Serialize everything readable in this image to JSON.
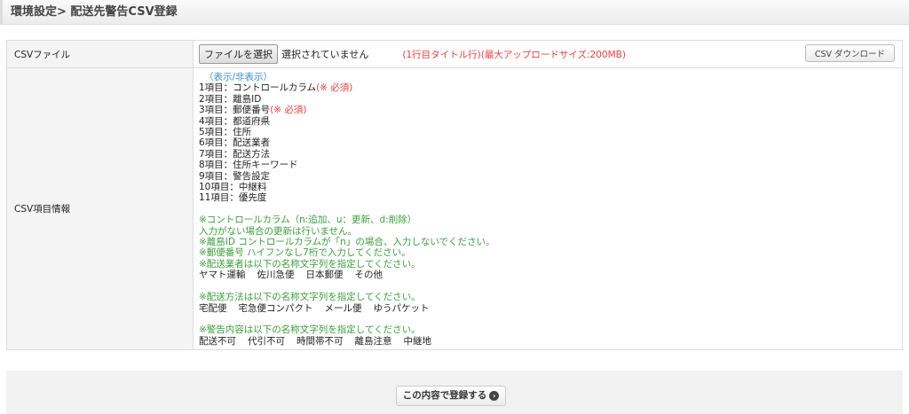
{
  "header": {
    "title": "環境設定> 配送先警告CSV登録"
  },
  "file_row": {
    "label": "CSVファイル",
    "choose_button": "ファイルを選択",
    "no_file": "選択されていません",
    "note": "(1行目タイトル行)(最大アップロードサイズ:200MB)",
    "download_button": "CSV ダウンロード"
  },
  "info_row": {
    "label": "CSV項目情報",
    "toggle": "（表示/非表示）",
    "items": [
      {
        "text": "1項目：コントロールカラム",
        "req": "(※ 必須)"
      },
      {
        "text": "2項目：離島ID",
        "req": ""
      },
      {
        "text": "3項目：郵便番号",
        "req": "(※ 必須)"
      },
      {
        "text": "4項目：都道府県",
        "req": ""
      },
      {
        "text": "5項目：住所",
        "req": ""
      },
      {
        "text": "6項目：配送業者",
        "req": ""
      },
      {
        "text": "7項目：配送方法",
        "req": ""
      },
      {
        "text": "8項目：住所キーワード",
        "req": ""
      },
      {
        "text": "9項目：警告設定",
        "req": ""
      },
      {
        "text": "10項目：中継料",
        "req": ""
      },
      {
        "text": "11項目：優先度",
        "req": ""
      }
    ],
    "notes": [
      "※コントロールカラム（n:追加、u：更新、d:削除）",
      "入力がない場合の更新は行いません。",
      "※離島ID コントロールカラムが「n」の場合、入力しないでください。",
      "※郵便番号 ハイフンなし7桁で入力してください。",
      "※配送業者は以下の名称文字列を指定してください。"
    ],
    "carriers": [
      "ヤマト運輸",
      "佐川急便",
      "日本郵便",
      "その他"
    ],
    "method_note": "※配送方法は以下の名称文字列を指定してください。",
    "methods": [
      "宅配便",
      "宅急便コンパクト",
      "メール便",
      "ゆうパケット"
    ],
    "warning_note": "※警告内容は以下の名称文字列を指定してください。",
    "warnings": [
      "配送不可",
      "代引不可",
      "時間帯不可",
      "離島注意",
      "中継地"
    ]
  },
  "footer": {
    "submit": "この内容で登録する"
  }
}
